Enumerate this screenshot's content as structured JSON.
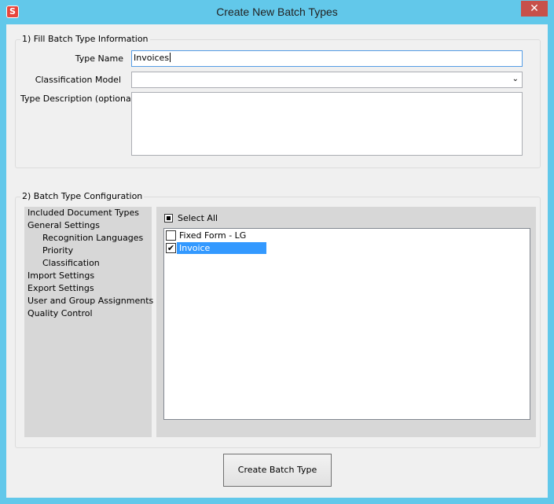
{
  "window": {
    "title": "Create New Batch Types",
    "app_icon_letter": "S",
    "close_symbol": "✕"
  },
  "section1": {
    "title": "1) Fill Batch Type Information",
    "type_name_label": "Type Name",
    "type_name_value": "Invoices",
    "classification_label": "Classification Model",
    "classification_value": "",
    "description_label": "Type Description (optional)",
    "description_value": ""
  },
  "section2": {
    "title": "2) Batch Type Configuration",
    "nav": [
      {
        "label": "Included Document Types",
        "indent": 0
      },
      {
        "label": "General Settings",
        "indent": 0
      },
      {
        "label": "Recognition Languages",
        "indent": 1
      },
      {
        "label": "Priority",
        "indent": 1
      },
      {
        "label": "Classification",
        "indent": 1
      },
      {
        "label": "Import Settings",
        "indent": 0
      },
      {
        "label": "Export Settings",
        "indent": 0
      },
      {
        "label": "User and Group Assignments",
        "indent": 0
      },
      {
        "label": "Quality Control",
        "indent": 0
      }
    ],
    "select_all_label": "Select All",
    "select_all_state": "indeterminate",
    "document_types": [
      {
        "label": "Fixed Form - LG",
        "checked": false,
        "selected": false
      },
      {
        "label": "Invoice",
        "checked": true,
        "selected": true
      }
    ]
  },
  "actions": {
    "create_label": "Create Batch Type"
  },
  "colors": {
    "title_bar": "#62c8ea",
    "selection": "#3399ff",
    "close_button": "#c7504a"
  }
}
